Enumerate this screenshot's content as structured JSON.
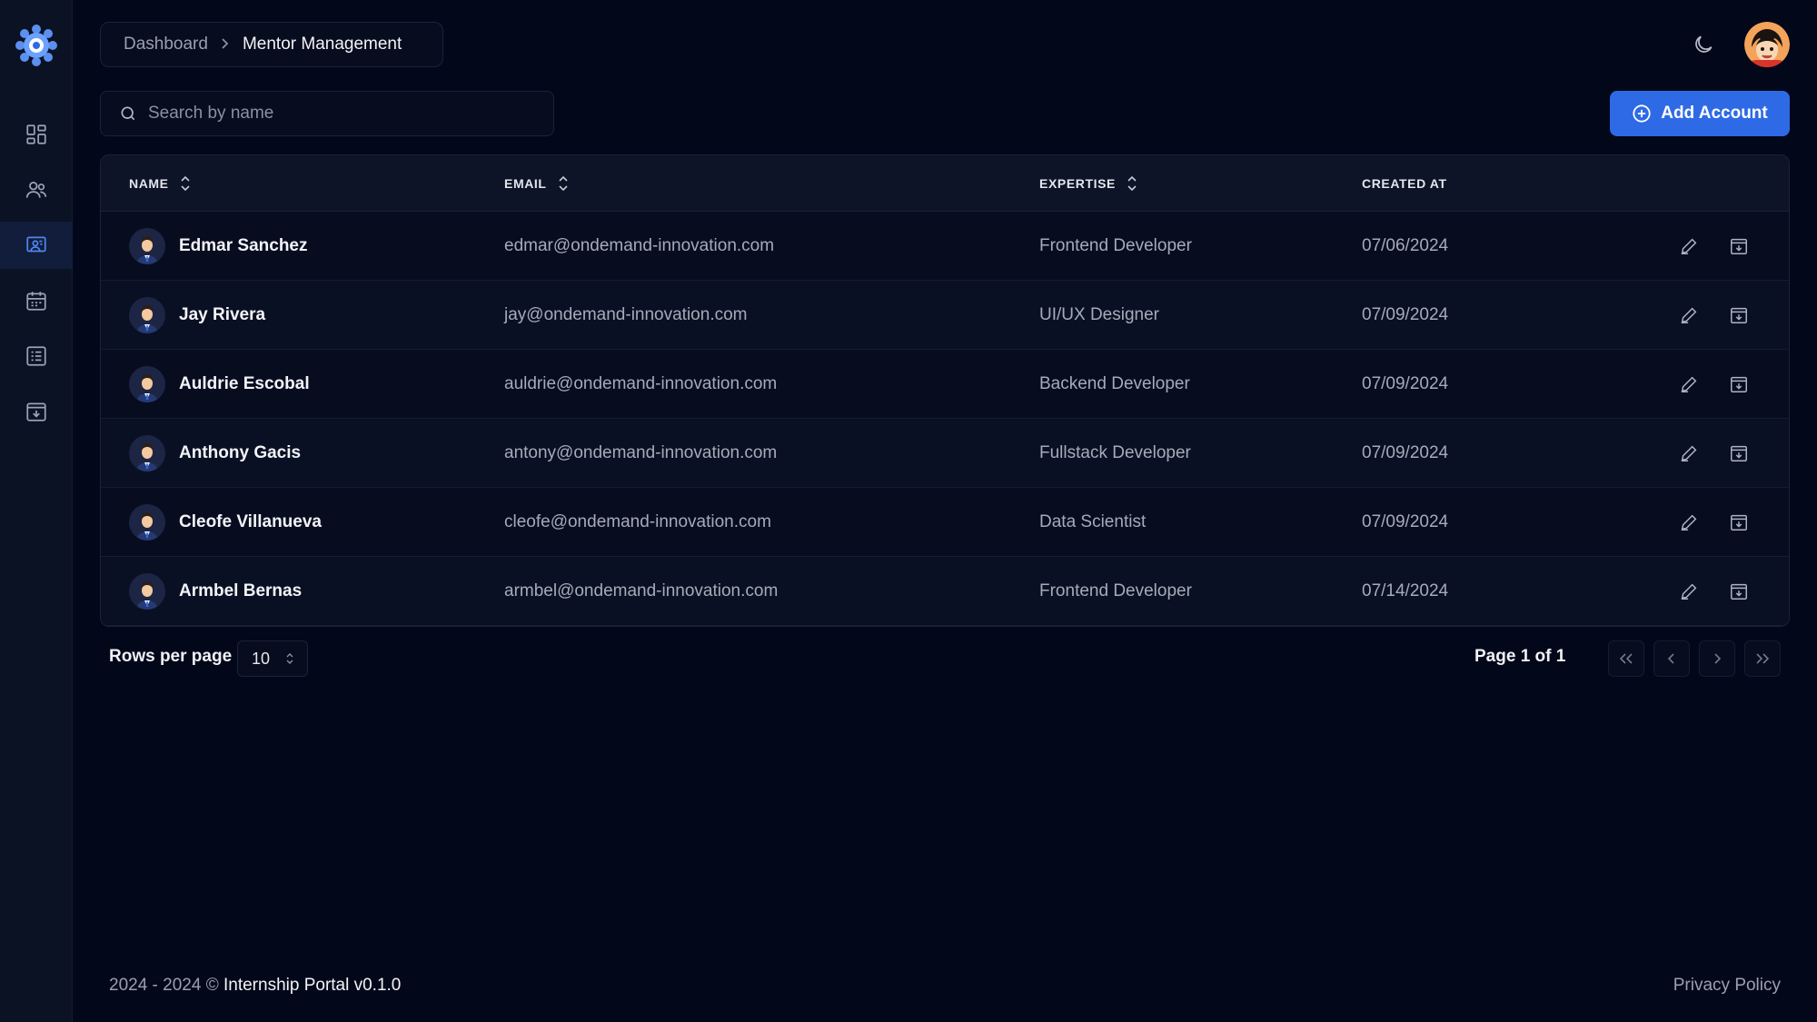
{
  "app": {
    "accent": "#2f6ae6",
    "background": "#03071a"
  },
  "sidebar": {
    "logo_icon": "gear-flower-logo-icon",
    "items": [
      {
        "name": "dashboard",
        "icon": "grid-icon",
        "active": false
      },
      {
        "name": "users",
        "icon": "users-icon",
        "active": false
      },
      {
        "name": "mentors",
        "icon": "presentation-icon",
        "active": true
      },
      {
        "name": "calendar",
        "icon": "calendar-icon",
        "active": false
      },
      {
        "name": "list",
        "icon": "list-icon",
        "active": false
      },
      {
        "name": "archive",
        "icon": "archive-icon",
        "active": false
      }
    ]
  },
  "header": {
    "breadcrumb": {
      "parent": "Dashboard",
      "separator": ">",
      "current": "Mentor Management"
    },
    "theme_icon": "moon-icon"
  },
  "toolbar": {
    "search_placeholder": "Search by name",
    "add_label": "Add Account"
  },
  "table": {
    "headers": {
      "name": "NAME",
      "email": "EMAIL",
      "expertise": "EXPERTISE",
      "created": "CREATED AT"
    },
    "rows": [
      {
        "name": "Edmar Sanchez",
        "email": "edmar@ondemand-innovation.com",
        "expertise": "Frontend Developer",
        "created": "07/06/2024"
      },
      {
        "name": "Jay Rivera",
        "email": "jay@ondemand-innovation.com",
        "expertise": "UI/UX Designer",
        "created": "07/09/2024"
      },
      {
        "name": "Auldrie Escobal",
        "email": "auldrie@ondemand-innovation.com",
        "expertise": "Backend Developer",
        "created": "07/09/2024"
      },
      {
        "name": "Anthony Gacis",
        "email": "antony@ondemand-innovation.com",
        "expertise": "Fullstack Developer",
        "created": "07/09/2024"
      },
      {
        "name": "Cleofe Villanueva",
        "email": "cleofe@ondemand-innovation.com",
        "expertise": "Data Scientist",
        "created": "07/09/2024"
      },
      {
        "name": "Armbel Bernas",
        "email": "armbel@ondemand-innovation.com",
        "expertise": "Frontend Developer",
        "created": "07/14/2024"
      }
    ]
  },
  "pagination": {
    "rows_label": "Rows per page",
    "rows_value": "10",
    "page_info": "Page 1 of 1"
  },
  "footer": {
    "years": "2024 - 2024 ©",
    "brand": "Internship Portal v0.1.0",
    "privacy": "Privacy Policy"
  }
}
